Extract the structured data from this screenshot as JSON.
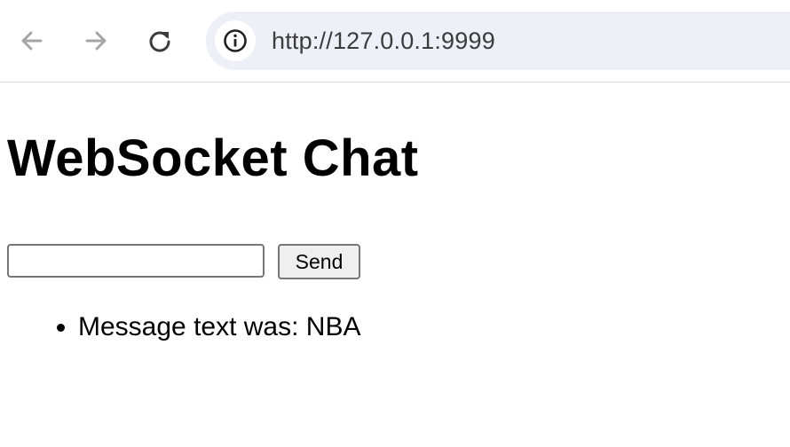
{
  "browser": {
    "url": "http://127.0.0.1:9999",
    "icons": {
      "back": "arrow-left-icon",
      "forward": "arrow-right-icon",
      "reload": "reload-icon",
      "site_info": "info-circle-icon"
    }
  },
  "page": {
    "title": "WebSocket Chat",
    "input": {
      "value": "",
      "placeholder": ""
    },
    "send_label": "Send",
    "messages": [
      "Message text was: NBA"
    ]
  }
}
